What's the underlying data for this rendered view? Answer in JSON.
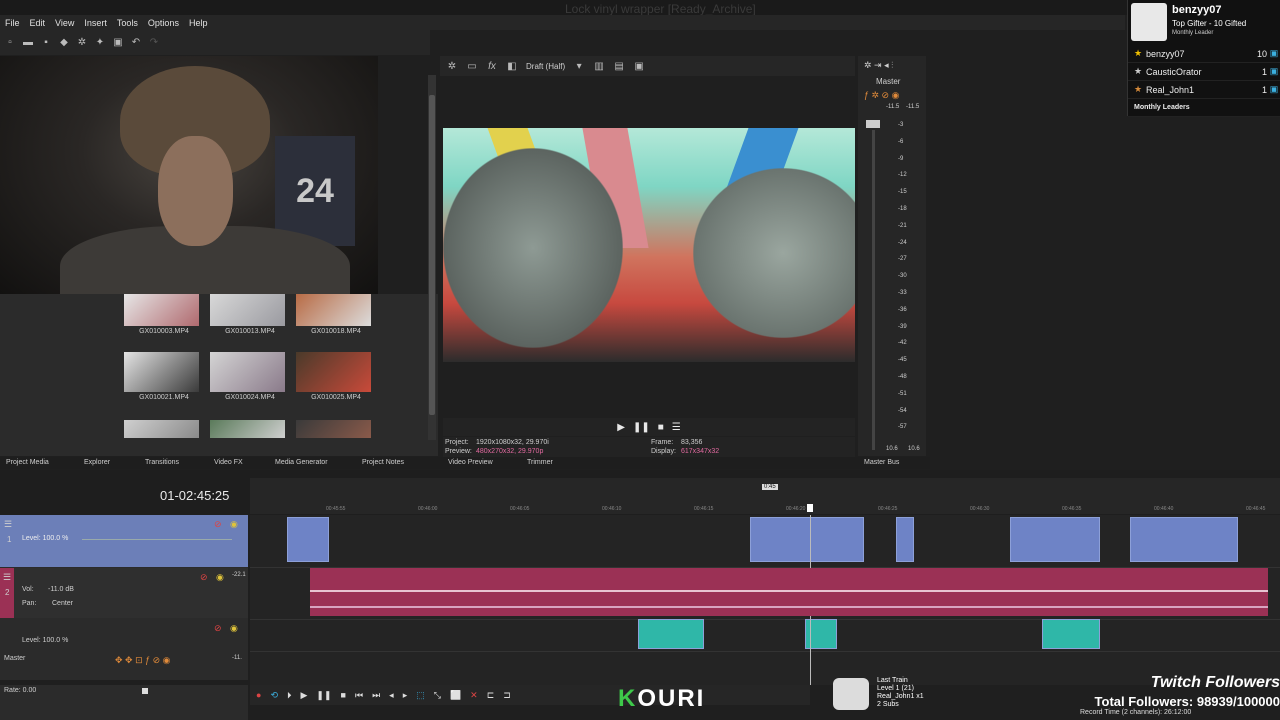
{
  "menu": [
    "File",
    "Edit",
    "View",
    "Insert",
    "Tools",
    "Options",
    "Help"
  ],
  "title_faded": "Lock vinyl wrapper [Ready_Archive]",
  "media": [
    {
      "name": "GX010003.MP4"
    },
    {
      "name": "GX010013.MP4"
    },
    {
      "name": "GX010018.MP4"
    },
    {
      "name": "GX010021.MP4"
    },
    {
      "name": "GX010024.MP4"
    },
    {
      "name": "GX010025.MP4"
    }
  ],
  "panel_tabs": [
    "Project Media",
    "Explorer",
    "Transitions",
    "Video FX",
    "Media Generator",
    "Project Notes"
  ],
  "preview_tabs": [
    "Video Preview",
    "Trimmer"
  ],
  "master_tab": "Master Bus",
  "preview": {
    "quality": "Draft (Half)",
    "project_label": "Project:",
    "project_value": "1920x1080x32, 29.970i",
    "preview_label": "Preview:",
    "preview_value": "480x270x32, 29.970p",
    "frame_label": "Frame:",
    "frame_value": "83,356",
    "display_label": "Display:",
    "display_value": "617x347x32"
  },
  "master": {
    "label": "Master",
    "left": "-11.5",
    "right": "-11.5",
    "scale": [
      "3",
      "6",
      "9",
      "12",
      "15",
      "18",
      "21",
      "24",
      "27",
      "30",
      "33",
      "36",
      "39",
      "42",
      "45",
      "48",
      "51",
      "54",
      "57"
    ],
    "bottom_left": "10.6",
    "bottom_right": "10.6"
  },
  "overlay": {
    "top_name": "benzyy07",
    "top_line1": "Top Gifter - 10 Gifted",
    "top_line2": "Monthly Leader",
    "leaders": [
      {
        "name": "benzyy07",
        "count": "10"
      },
      {
        "name": "CausticOrator",
        "count": "1"
      },
      {
        "name": "Real_John1",
        "count": "1"
      }
    ],
    "footer": "Monthly Leaders"
  },
  "timeline": {
    "timecode": "01-02:45:25",
    "marker": "0:45",
    "ticks": [
      "00:45:55",
      "00:46:00",
      "00:46:05",
      "00:46:10",
      "00:46:15",
      "00:46:20",
      "00:46:25",
      "00:46:30",
      "00:46:35",
      "00:46:40",
      "00:46:45"
    ]
  },
  "tracks": {
    "video1_level": "Level: 100.0 %",
    "audio_vol_label": "Vol:",
    "audio_vol": "-11.0 dB",
    "audio_pan_label": "Pan:",
    "audio_pan": "Center",
    "video2_level": "Level: 100.0 %",
    "master_label": "Master",
    "rate": "Rate: 0.00",
    "track_num_1": "1",
    "track_num_2": "2",
    "db_top": "-22.1",
    "db_master": "-11."
  },
  "stream": {
    "kouri_k": "K",
    "kouri_rest": "OURI",
    "train_title": "Last Train",
    "train_level": "Level 1 (21)",
    "train_user": "Real_John1 x1",
    "train_subs": "2 Subs",
    "twitch_label": "Twitch Followers",
    "total_label": "Total Followers: 98939/100000",
    "record": "Record Time (2 channels): 26:12:00"
  }
}
